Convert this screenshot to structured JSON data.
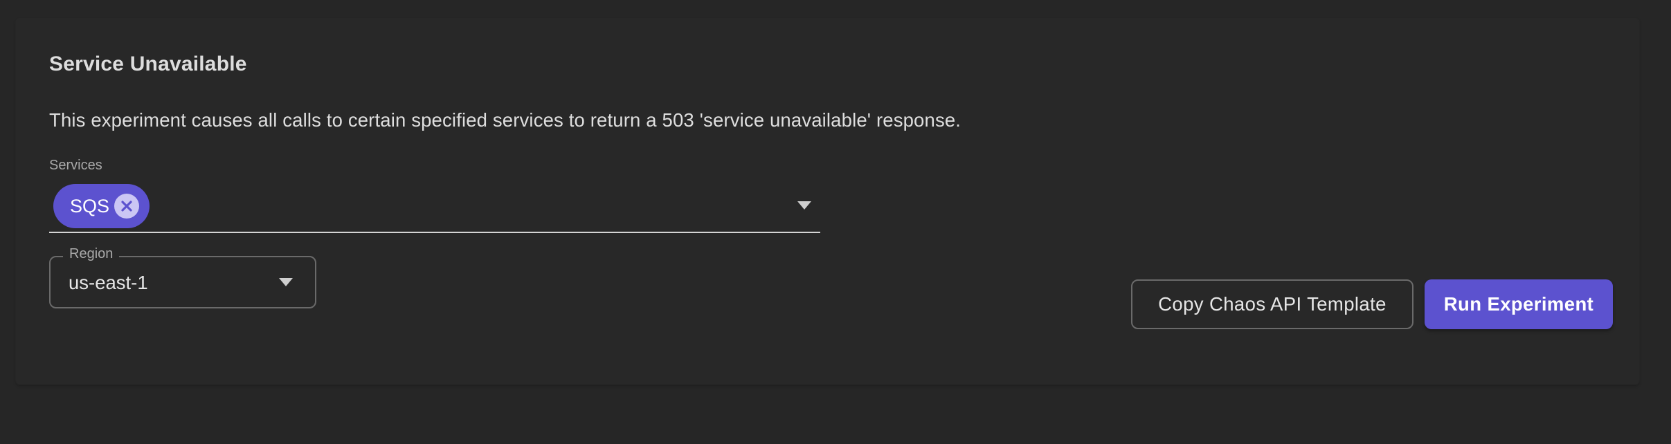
{
  "experiment": {
    "title": "Service Unavailable",
    "description": "This experiment causes all calls to certain specified services to return a 503 'service unavailable' response."
  },
  "services": {
    "label": "Services",
    "selected": [
      {
        "label": "SQS"
      }
    ],
    "dropdown_icon": "caret-down-icon",
    "remove_icon": "close-icon"
  },
  "region": {
    "label": "Region",
    "value": "us-east-1",
    "dropdown_icon": "caret-down-icon"
  },
  "actions": {
    "copy_template_label": "Copy Chaos API Template",
    "run_label": "Run Experiment"
  },
  "colors": {
    "background": "#262626",
    "card": "#282828",
    "accent": "#5c52cf",
    "chip_remove": "#cbc6f4",
    "text": "#e2e2e2",
    "muted_text": "#a9a9a9",
    "outline": "#6a6a6a"
  }
}
